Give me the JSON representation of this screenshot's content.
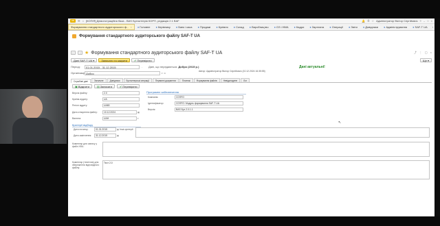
{
  "window": {
    "title": "[КОПІЯ] Демонстраційна база - BAS Бухгалтерія КОРП, редакція 2.1 BAF",
    "user": "Адміністратор Віктор Сергійович"
  },
  "menu": {
    "active_tab": "Формування стандартного аудиторського ф...",
    "items": [
      {
        "label": "Головне",
        "icon": "home-icon"
      },
      {
        "label": "Керівнику",
        "icon": "chart-icon"
      },
      {
        "label": "Банк і каса",
        "icon": "bank-icon"
      },
      {
        "label": "Продажі",
        "icon": "cart-icon"
      },
      {
        "label": "Купівля",
        "icon": "basket-icon"
      },
      {
        "label": "Склад",
        "icon": "box-icon"
      },
      {
        "label": "Виробництво",
        "icon": "factory-icon"
      },
      {
        "label": "ОЗ і НМА",
        "icon": "asset-icon"
      },
      {
        "label": "Кадри",
        "icon": "people-icon"
      },
      {
        "label": "Зарплата",
        "icon": "money-icon"
      },
      {
        "label": "Операції",
        "icon": "ops-icon"
      },
      {
        "label": "Звіти",
        "icon": "report-icon"
      },
      {
        "label": "Довідники",
        "icon": "book-icon"
      },
      {
        "label": "Адміністрування",
        "icon": "gear-icon"
      },
      {
        "label": "SAF-T UA",
        "icon": "doc-icon"
      }
    ]
  },
  "header_doc": {
    "title": "Формування стандартного аудиторського файлу SAF-T UA"
  },
  "form": {
    "title": "Формування стандартного аудиторського файлу SAF-T UA",
    "commands": {
      "saft_btn": "Дані SAF-T UA",
      "save_close": "Записати та закрити",
      "check": "Перевірити",
      "more": "Ще"
    },
    "period_label": "Період:",
    "period_value": "01.01.2015 - 31.12.2015",
    "org_label": "Організація:",
    "org_value": "Добро",
    "doc_label": "Дані, що передаються:",
    "doc_value": "Добро (2015 р.)",
    "author_line": "Автор: Адміністратор Віктор Сергійович (10.12.2024 16:35:55)",
    "status": "Дані актуальні!",
    "tabs": [
      "Службові дані",
      "Загальне",
      "Довідники",
      "Бухгалтерські операції",
      "Первинні документи",
      "Платежі",
      "Формування файлів",
      "Невідкладене",
      "Лог"
    ],
    "subcommands": [
      "Відкрити",
      "Записати",
      "Перевірити"
    ],
    "fields": {
      "file_version_label": "Версія файлу:",
      "file_version": "2.0",
      "country_label": "Країна аудиту:",
      "country": "UA",
      "region_label": "Регіон аудиту:",
      "region": "UA80",
      "create_date_label": "Дата створення файлу:",
      "create_date": "10.12.2024",
      "currency_label": "Валюта:",
      "currency": "UAH"
    },
    "software_group": {
      "title": "Програмне забезпечення",
      "provider_label": "Компанія:",
      "provider": "СОФТО",
      "id_label": "Ідентифікатор:",
      "id": "СОФТО: Модуль формування SAF-T UA",
      "version_label": "Версія:",
      "version": "BAS Бух 2.0.1.1"
    },
    "selection_group": {
      "title": "Критерії відбору",
      "start_label": "Дата початку:",
      "start": "01.01.2015",
      "end_label": "Дата закінчення:",
      "end": "31.12.2015",
      "other_label": "Інші критерії:"
    },
    "comment_label": "Коментар для запису у файл XML:",
    "comment2_label": "Коментар (технічна) для збереження відповідного файлу:",
    "comment2_value": "Тест 2.0"
  }
}
